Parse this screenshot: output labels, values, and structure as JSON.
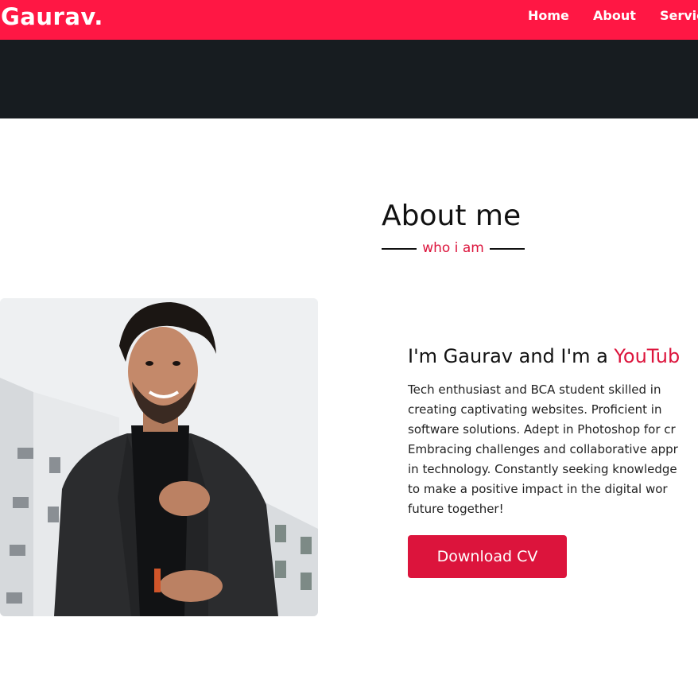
{
  "navbar": {
    "logo": "Gaurav.",
    "links": [
      "Home",
      "About",
      "Service"
    ]
  },
  "about": {
    "title": "About me",
    "subtitle": "who i am",
    "heading_prefix": "I'm Gaurav and I'm a ",
    "heading_role": "YouTub",
    "bio_lines": [
      "Tech enthusiast and BCA student skilled in",
      "creating captivating websites. Proficient in",
      "software solutions. Adept in Photoshop for cr",
      "Embracing challenges and collaborative appr",
      "in technology. Constantly seeking knowledge",
      "to make a positive impact in the digital wor",
      "future together!"
    ],
    "cv_button": "Download CV"
  },
  "colors": {
    "nav_bg": "#ff1744",
    "hero_bg": "#171c20",
    "accent": "#dc143c"
  }
}
